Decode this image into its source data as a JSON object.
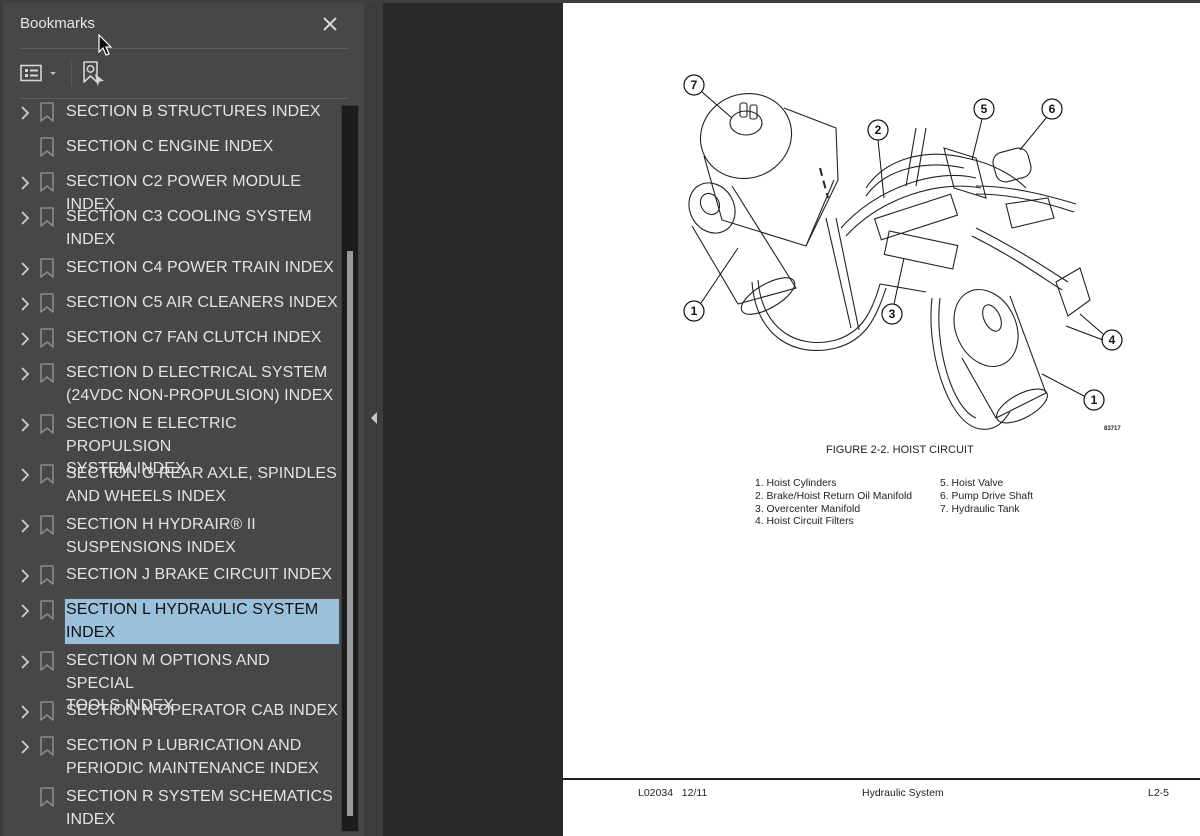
{
  "panel": {
    "title": "Bookmarks",
    "close_icon": "close-icon",
    "options_icon": "list-options-icon",
    "find_bookmark_icon": "find-current-bookmark-icon"
  },
  "bookmarks": [
    {
      "label_lines": [
        "SECTION B STRUCTURES INDEX"
      ],
      "expandable": true,
      "selected": false
    },
    {
      "label_lines": [
        "SECTION C ENGINE INDEX"
      ],
      "expandable": false,
      "selected": false
    },
    {
      "label_lines": [
        "SECTION C2 POWER MODULE INDEX"
      ],
      "expandable": true,
      "selected": false
    },
    {
      "label_lines": [
        "SECTION C3 COOLING SYSTEM",
        "INDEX"
      ],
      "expandable": true,
      "selected": false
    },
    {
      "label_lines": [
        "SECTION C4 POWER TRAIN INDEX"
      ],
      "expandable": true,
      "selected": false
    },
    {
      "label_lines": [
        "SECTION C5 AIR CLEANERS INDEX"
      ],
      "expandable": true,
      "selected": false
    },
    {
      "label_lines": [
        "SECTION C7 FAN CLUTCH INDEX"
      ],
      "expandable": true,
      "selected": false
    },
    {
      "label_lines": [
        "SECTION D ELECTRICAL SYSTEM",
        "(24VDC NON-PROPULSION) INDEX"
      ],
      "expandable": true,
      "selected": false
    },
    {
      "label_lines": [
        "SECTION E ELECTRIC PROPULSION",
        "SYSTEM INDEX"
      ],
      "expandable": true,
      "selected": false
    },
    {
      "label_lines": [
        "SECTION G REAR AXLE, SPINDLES",
        "AND WHEELS INDEX"
      ],
      "expandable": true,
      "selected": false
    },
    {
      "label_lines": [
        "SECTION H HYDRAIR® II",
        "SUSPENSIONS INDEX"
      ],
      "expandable": true,
      "selected": false
    },
    {
      "label_lines": [
        "SECTION J BRAKE CIRCUIT INDEX"
      ],
      "expandable": true,
      "selected": false
    },
    {
      "label_lines": [
        "SECTION L HYDRAULIC SYSTEM",
        "INDEX"
      ],
      "expandable": true,
      "selected": true
    },
    {
      "label_lines": [
        "SECTION M OPTIONS AND SPECIAL",
        "TOOLS INDEX"
      ],
      "expandable": true,
      "selected": false
    },
    {
      "label_lines": [
        "SECTION N OPERATOR CAB INDEX"
      ],
      "expandable": true,
      "selected": false
    },
    {
      "label_lines": [
        "SECTION P LUBRICATION AND",
        "PERIODIC MAINTENANCE INDEX"
      ],
      "expandable": true,
      "selected": false
    },
    {
      "label_lines": [
        "SECTION R SYSTEM SCHEMATICS",
        "INDEX"
      ],
      "expandable": false,
      "selected": false
    }
  ],
  "colors": {
    "panel_bg": "#474747",
    "viewport_bg": "#282828",
    "selection": "#9ac0dc",
    "text": "#e3e3e3"
  },
  "document": {
    "figure": {
      "callouts": [
        "7",
        "2",
        "5",
        "6",
        "1",
        "3",
        "4",
        "1"
      ],
      "id": "83717",
      "caption": "FIGURE 2-2. HOIST CIRCUIT"
    },
    "legend_col1": [
      "1. Hoist Cylinders",
      "2. Brake/Hoist Return Oil Manifold",
      "3. Overcenter Manifold",
      "4. Hoist Circuit Filters"
    ],
    "legend_col2": [
      "5. Hoist Valve",
      "6. Pump Drive Shaft",
      "7. Hydraulic Tank"
    ],
    "footer": {
      "doc": "L02034   12/11",
      "title": "Hydraulic System",
      "page": "L2-5"
    }
  }
}
